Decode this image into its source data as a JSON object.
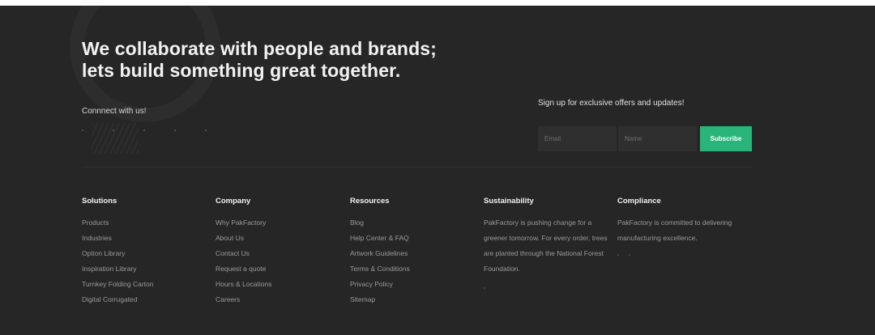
{
  "headline": {
    "line1": "We collaborate with people and brands;",
    "line2": "lets build something great together."
  },
  "connect": {
    "label": "Connnect with us!"
  },
  "signup": {
    "label": "Sign up for exclusive offers and updates!",
    "email_placeholder": "Email",
    "name_placeholder": "Name",
    "subscribe_label": "Subscribe"
  },
  "colors": {
    "background": "#262626",
    "accent": "#29b47a",
    "link": "#9a9a9a",
    "heading": "#f2f2f2"
  },
  "columns": {
    "solutions": {
      "title": "Solutions",
      "links": [
        "Products",
        "Industries",
        "Option Library",
        "Inspiration Library",
        "Turnkey Folding Carton",
        "Digital Corrugated"
      ]
    },
    "company": {
      "title": "Company",
      "links": [
        "Why PakFactory",
        "About Us",
        "Contact Us",
        "Request a quote",
        "Hours & Locations",
        "Careers"
      ]
    },
    "resources": {
      "title": "Resources",
      "links": [
        "Blog",
        "Help Center & FAQ",
        "Artwork Guidelines",
        "Terms & Conditions",
        "Privacy Policy",
        "Sitemap"
      ]
    },
    "sustainability": {
      "title": "Sustainability",
      "text": "PakFactory is pushing change for a greener tomorrow. For every order, trees are planted through the National Forest Foundation."
    },
    "compliance": {
      "title": "Compliance",
      "text": "PakFactory is committed to delivering manufacturing excellence."
    }
  }
}
